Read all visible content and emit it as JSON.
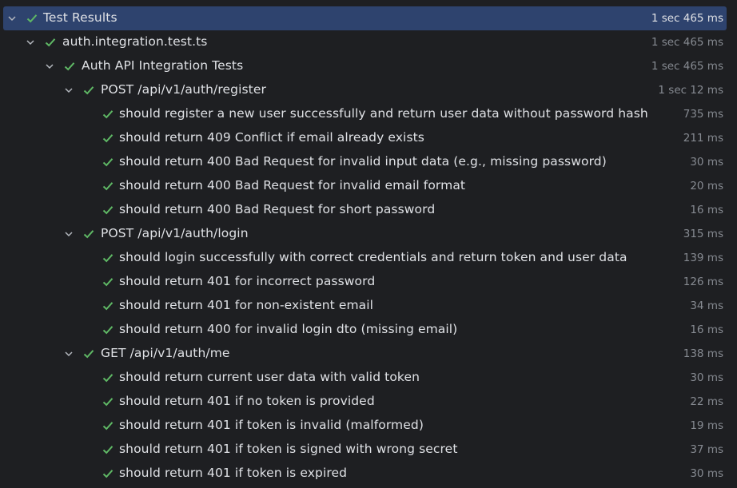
{
  "colors": {
    "background": "#1e1f22",
    "selection": "#2e436e",
    "check": "#5fb865",
    "text": "#dfe1e5",
    "duration": "#868a91"
  },
  "tree": {
    "root": {
      "label": "Test Results",
      "duration": "1 sec 465 ms",
      "icon": "check-icon",
      "expanded": true
    },
    "file": {
      "label": "auth.integration.test.ts",
      "duration": "1 sec 465 ms",
      "icon": "check-icon",
      "expanded": true
    },
    "suite": {
      "label": "Auth API Integration Tests",
      "duration": "1 sec 465 ms",
      "icon": "check-icon",
      "expanded": true
    },
    "groups": [
      {
        "label": "POST /api/v1/auth/register",
        "duration": "1 sec 12 ms",
        "tests": [
          {
            "label": "should register a new user successfully and return user data without password hash",
            "duration": "735 ms"
          },
          {
            "label": "should return 409 Conflict if email already exists",
            "duration": "211 ms"
          },
          {
            "label": "should return 400 Bad Request for invalid input data (e.g., missing password)",
            "duration": "30 ms"
          },
          {
            "label": "should return 400 Bad Request for invalid email format",
            "duration": "20 ms"
          },
          {
            "label": "should return 400 Bad Request for short password",
            "duration": "16 ms"
          }
        ]
      },
      {
        "label": "POST /api/v1/auth/login",
        "duration": "315 ms",
        "tests": [
          {
            "label": "should login successfully with correct credentials and return token and user data",
            "duration": "139 ms"
          },
          {
            "label": "should return 401 for incorrect password",
            "duration": "126 ms"
          },
          {
            "label": "should return 401 for non-existent email",
            "duration": "34 ms"
          },
          {
            "label": "should return 400 for invalid login dto (missing email)",
            "duration": "16 ms"
          }
        ]
      },
      {
        "label": "GET /api/v1/auth/me",
        "duration": "138 ms",
        "tests": [
          {
            "label": "should return current user data with valid token",
            "duration": "30 ms"
          },
          {
            "label": "should return 401 if no token is provided",
            "duration": "22 ms"
          },
          {
            "label": "should return 401 if token is invalid (malformed)",
            "duration": "19 ms"
          },
          {
            "label": "should return 401 if token is signed with wrong secret",
            "duration": "37 ms"
          },
          {
            "label": "should return 401 if token is expired",
            "duration": "30 ms"
          }
        ]
      }
    ]
  }
}
